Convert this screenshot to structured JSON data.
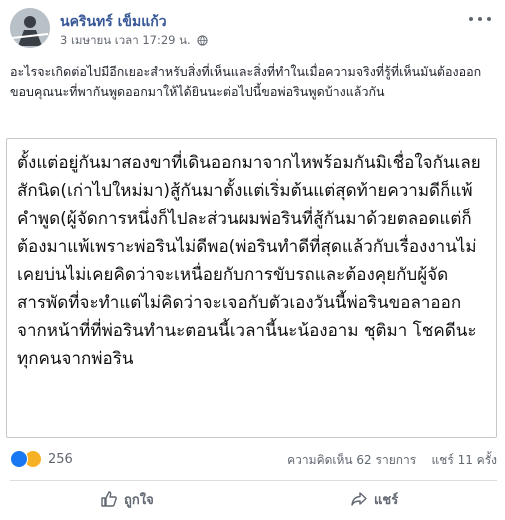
{
  "post": {
    "author": "นครินทร์ เข็มแก้ว",
    "timestamp": "3 เมษายน เวลา 17:29 น.",
    "caption": "อะไรจะเกิดต่อไปมีอีกเยอะสำหรับสิ่งที่เห็นและสิ่งที่ทำในเมื่อความจริงที่รู้ที่เห็นมันต้องออกขอบคุณนะที่พากันพูดออกมาให้ได้ยินนะต่อไปนี้ขอพ่อรินพูดบ้างแล้วกัน",
    "card_text": "ตั้งแต่อยู่กันมาสองขาที่เดินออกมาจากไหพร้อมกันมิเชื่อใจกันเลยสักนิด(เก่าไปใหม่มา)สู้กันมาตั้งแต่เริ่มต้นแต่สุดท้ายความดีก็แพ้คำพูด(ผู้จัดการหนึ่งก็ไปละส่วนผมพ่อรินที่สู้กันมาด้วยตลอดแต่ก็ต้องมาแพ้เพราะพ่อรินไม่ดีพอ(พ่อรินทำดีที่สุดแล้วกับเรื่องงานไม่เคยบ่นไม่เคยคิดว่าจะเหนื่อยกับการขับรถและต้องคุยกับผู้จัดสารพัดที่จะทำแต่ไม่คิดว่าจะเจอกับตัวเองวันนี้พ่อรินขอลาออกจากหน้าที่ที่พ่อรินทำนะตอนนี้เวลานี้นะน้องอาม ชุติมา  โชคดีนะทุกคนจากพ่อริน"
  },
  "reactions": {
    "count": "256",
    "icons": [
      "like-reaction",
      "sad-reaction"
    ]
  },
  "stats": {
    "comments": "ความคิดเห็น 62 รายการ",
    "shares": "แชร์ 11 ครั้ง"
  },
  "actions": {
    "like_label": "ถูกใจ",
    "share_label": "แชร์"
  },
  "colors": {
    "author": "#385898",
    "meta": "#616770",
    "like_blue": "#1877f2",
    "sad_yellow": "#f7b125"
  }
}
